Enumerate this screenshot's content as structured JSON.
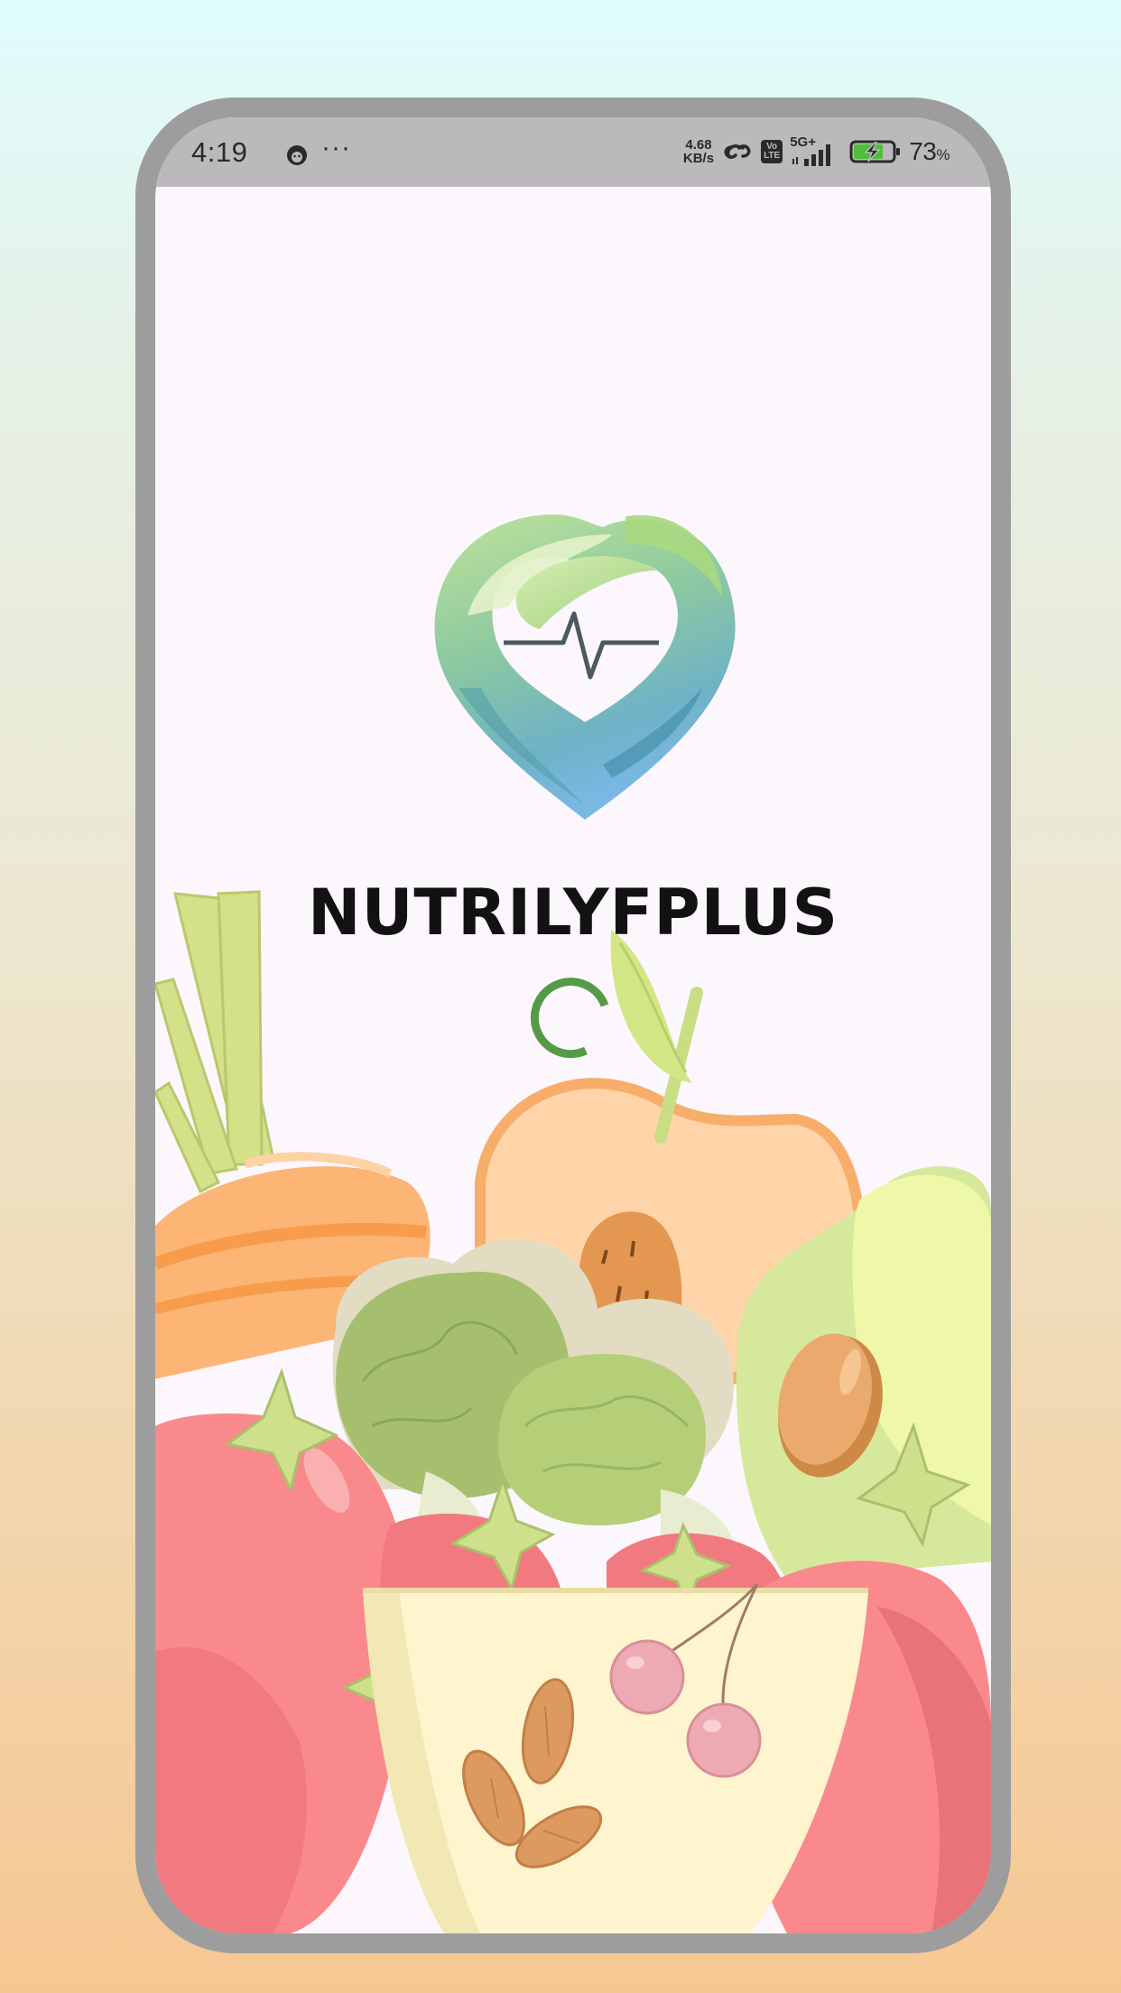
{
  "status_bar": {
    "time": "4:19",
    "dots": "···",
    "net_speed_value": "4.68",
    "net_speed_unit": "KB/s",
    "volte_top": "Vo",
    "volte_bottom": "LTE",
    "network_type": "5G+",
    "battery_percent": "73",
    "battery_percent_sign": "%",
    "battery_level": 0.73,
    "charging": true,
    "icons": [
      "face-icon",
      "link-icon",
      "volte-icon",
      "signal-icon",
      "battery-charging-icon"
    ]
  },
  "splash": {
    "app_name": "NUTRILYFPLUS",
    "logo": "heart-leaf-heartbeat-logo",
    "loading": true,
    "spinner_color": "#559b47"
  },
  "colors": {
    "frame": "#9d9d9d",
    "screen_background": "#fcf6fd",
    "status_bar_background": "#bcb9bd"
  }
}
